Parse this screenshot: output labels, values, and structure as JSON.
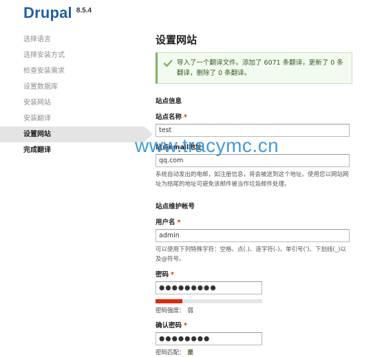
{
  "brand": {
    "name": "Drupal",
    "version": "8.5.4"
  },
  "steps": [
    {
      "label": "选择语言",
      "state": "done"
    },
    {
      "label": "选择安装方式",
      "state": "done"
    },
    {
      "label": "检查安装需求",
      "state": "done"
    },
    {
      "label": "设置数据库",
      "state": "done"
    },
    {
      "label": "安装网站",
      "state": "done"
    },
    {
      "label": "安装翻译",
      "state": "done"
    },
    {
      "label": "设置网站",
      "state": "active"
    },
    {
      "label": "完成翻译",
      "state": "todo"
    }
  ],
  "main": {
    "title": "设置网站",
    "message": "导入了一个翻译文件。添加了 6071 条翻译，更新了 0 条翻译，删除了 0 条翻译。",
    "site_info": {
      "legend": "站点信息",
      "name_label": "站点名称",
      "name_value": "test",
      "email_label": "站点email地址",
      "email_value": "qq.com",
      "email_desc": "系统自动发出的电邮，如注册信息，将会被送到这个地址。使用您以网站网址为结尾的地址可避免该邮件被当作垃圾邮件处理。"
    },
    "account": {
      "legend": "站点维护帐号",
      "username_label": "用户名",
      "username_value": "admin",
      "username_desc": "可以使用下列特殊字符：空格、点(.)、连字符(-)、单引号(')、下划线(_)以及@符号。",
      "password_label": "密码",
      "password_value": "●●●●●●●●●",
      "strength_fraction": 0.25,
      "strength_label": "密码强度：",
      "strength_value": "弱",
      "confirm_label": "确认密码",
      "confirm_value": "●●●●●●●●",
      "match_label": "密码匹配：",
      "match_value": "是"
    }
  },
  "watermark": "www.tracymc.cn",
  "colors": {
    "brand": "#1f5fa8",
    "success": "#77b259",
    "required": "#e62600"
  }
}
